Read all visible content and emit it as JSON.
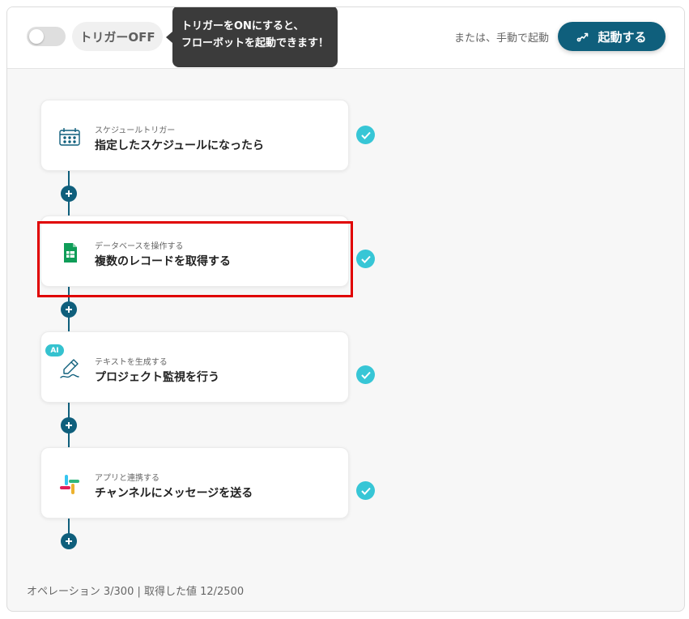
{
  "header": {
    "toggle_state": "off",
    "trigger_label": "トリガーOFF",
    "tooltip_line1": "トリガーをONにすると、",
    "tooltip_line2": "フローボットを起動できます！",
    "manual_text": "または、手動で起動",
    "start_button_label": "起動する"
  },
  "steps": [
    {
      "category": "スケジュールトリガー",
      "title": "指定したスケジュールになったら",
      "icon": "calendar-clock-icon",
      "completed": true
    },
    {
      "category": "データベースを操作する",
      "title": "複数のレコードを取得する",
      "icon": "google-sheets-icon",
      "completed": true,
      "highlighted": true
    },
    {
      "category": "テキストを生成する",
      "title": "プロジェクト監視を行う",
      "icon": "ai-pen-icon",
      "badge": "AI",
      "completed": true
    },
    {
      "category": "アプリと連携する",
      "title": "チャンネルにメッセージを送る",
      "icon": "slack-icon",
      "completed": true
    }
  ],
  "footer": {
    "text": "オペレーション 3/300 | 取得した値 12/2500"
  },
  "colors": {
    "primary": "#0f5f7c",
    "check": "#37c6d6",
    "highlight_border": "#e00000",
    "tooltip_bg": "#3b3b3b",
    "ai_badge": "#35c2cf"
  }
}
